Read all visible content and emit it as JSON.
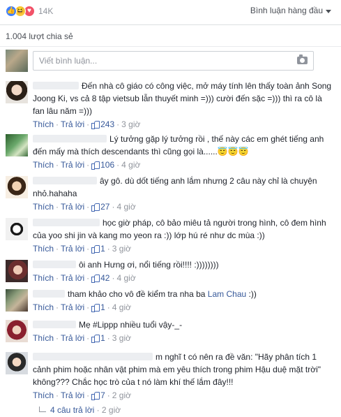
{
  "reactions": {
    "icons": [
      "like-icon",
      "haha-icon",
      "love-icon"
    ],
    "count": "14K"
  },
  "sort": {
    "label": "Bình luận hàng đầu"
  },
  "shares": {
    "text": "1.004 lượt chia sẻ"
  },
  "composer": {
    "placeholder": "Viết bình luận..."
  },
  "comments": [
    {
      "text": "Đến nhà cô giáo có công việc, mở máy tính lên thấy toàn ảnh Song Joong Ki, vs cả 8 tập vietsub lẫn thuyết minh =))) cười đến sặc =))) thì ra cô là fan lâu năm =)))",
      "actions": {
        "like": "Thích",
        "reply": "Trả lời",
        "likes": "243",
        "time": "3 giờ"
      }
    },
    {
      "text": "Lý tưởng gặp lý tưởng rồi , thế này các em ghét tiếng anh đến mấy mà thích descendants thì cũng gọi là......😇😇😇",
      "actions": {
        "like": "Thích",
        "reply": "Trả lời",
        "likes": "106",
        "time": "4 giờ"
      }
    },
    {
      "text": "ây gô. dù dốt tiếng anh lắm nhưng 2 câu này chỉ là chuyện nhỏ.hahaha",
      "actions": {
        "like": "Thích",
        "reply": "Trả lời",
        "likes": "27",
        "time": "4 giờ"
      }
    },
    {
      "text": "học giờ pháp, cô bảo miêu tả người trong hình, cô đem hình của yoo shi jin và kang mo yeon ra :)) lớp hú ré như dc mùa :))",
      "actions": {
        "like": "Thích",
        "reply": "Trả lời",
        "likes": "1",
        "time": "3 giờ"
      }
    },
    {
      "text": "ôi anh Hưng ơi, nổi tiếng rồi!!!! :))))))))",
      "actions": {
        "like": "Thích",
        "reply": "Trả lời",
        "likes": "42",
        "time": "4 giờ"
      }
    },
    {
      "text_before": "tham khảo cho vô đề kiểm tra nha ba ",
      "mention": "Lam Chau",
      "text_after": " :))",
      "actions": {
        "like": "Thích",
        "reply": "Trả lời",
        "likes": "1",
        "time": "4 giờ"
      }
    },
    {
      "text": "Mẹ #Lippp nhiều tuổi vậy-_-",
      "actions": {
        "like": "Thích",
        "reply": "Trả lời",
        "likes": "1",
        "time": "3 giờ"
      }
    },
    {
      "text": "m nghĩ t có nên ra đề văn: \"Hãy phân tích 1 cảnh phim hoặc nhân vật phim mà em yêu thích trong phim Hậu duệ mặt trời\" không??? Chắc học trò của t nó làm khí thế lắm đây!!!",
      "actions": {
        "like": "Thích",
        "reply": "Trả lời",
        "likes": "7",
        "time": "2 giờ"
      }
    }
  ],
  "replies": {
    "label": "4 câu trả lời",
    "time": "2 giờ"
  }
}
